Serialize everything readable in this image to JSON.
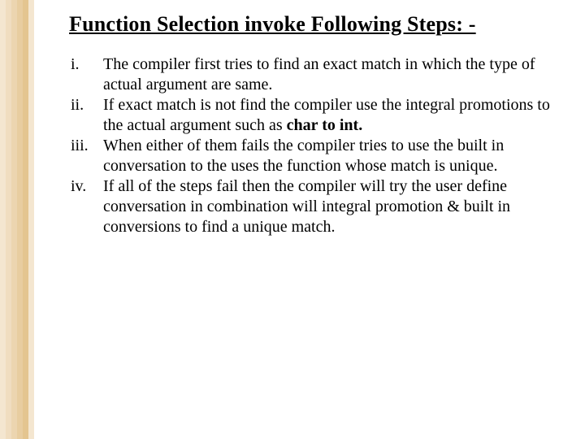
{
  "title": "Function Selection invoke Following Steps: -",
  "items": [
    {
      "marker": "i.",
      "text_a": "The compiler first tries to find an exact match in which the type of actual argument are same."
    },
    {
      "marker": "ii.",
      "text_a": "If exact match is not find the compiler use the integral promotions to the actual argument such as ",
      "bold": "char to int."
    },
    {
      "marker": "iii.",
      "text_a": "When either of them fails the compiler tries to use the built in conversation to the uses the function whose match is unique."
    },
    {
      "marker": "iv.",
      "text_a": "If all of the steps fail then the compiler will try the user define conversation in combination will integral promotion & built in conversions to find a unique match."
    }
  ]
}
